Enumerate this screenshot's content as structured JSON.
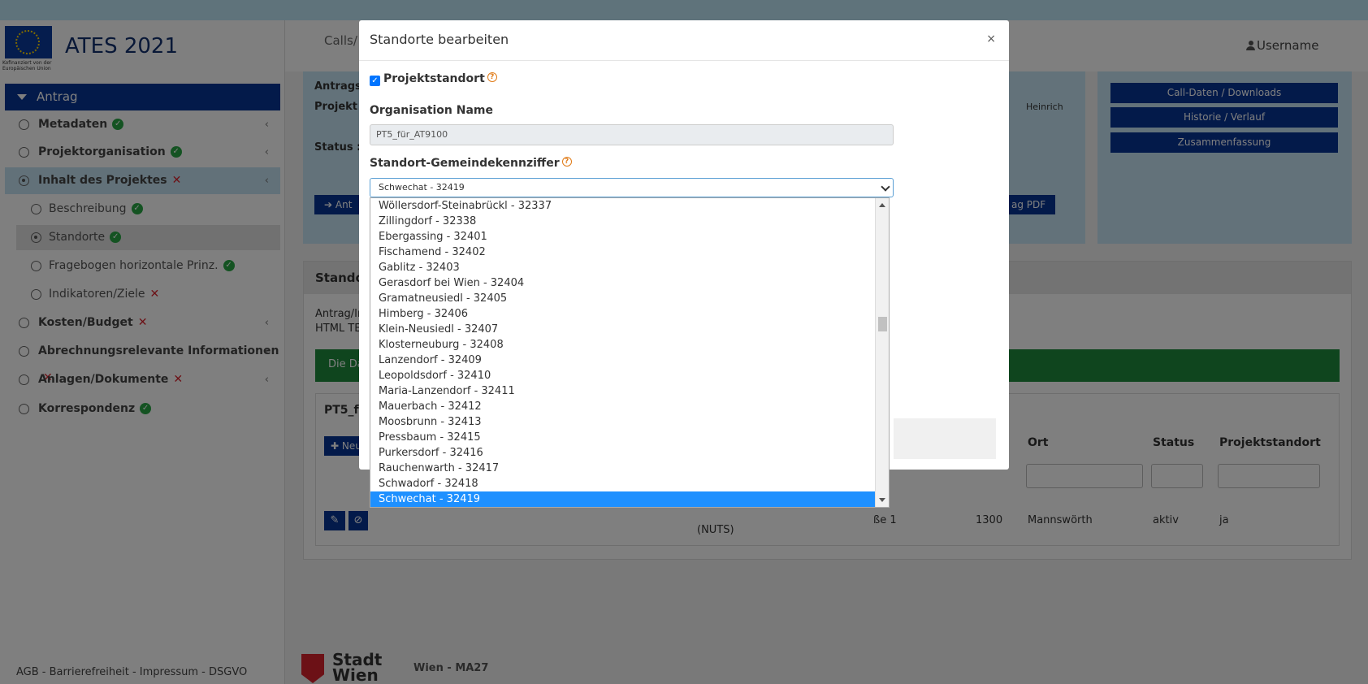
{
  "app": {
    "title": "ATES 2021",
    "logo_caption": "Kofinanziert von der Europäischen Union"
  },
  "sidebar": {
    "active_label": "Antrag",
    "items": [
      {
        "label": "Metadaten",
        "status": "ok"
      },
      {
        "label": "Projektorganisation",
        "status": "ok"
      },
      {
        "label": "Inhalt des Projektes",
        "status": "error"
      },
      {
        "label": "Beschreibung",
        "status": "ok"
      },
      {
        "label": "Standorte",
        "status": "ok"
      },
      {
        "label": "Fragebogen horizontale Prinz.",
        "status": "ok"
      },
      {
        "label": "Indikatoren/Ziele",
        "status": "error"
      },
      {
        "label": "Kosten/Budget",
        "status": "error"
      },
      {
        "label": "Abrechnungsrelevante Informationen",
        "status": "error"
      },
      {
        "label": "Anlagen/Dokumente",
        "status": "error"
      },
      {
        "label": "Korrespondenz",
        "status": "ok"
      }
    ],
    "footer": "AGB - Barrierefreiheit - Impressum - DSGVO"
  },
  "header": {
    "calls": "Calls/",
    "user": "Username"
  },
  "info": {
    "antrag": "Antrags",
    "projekt": "Projekt I",
    "status": "Status :",
    "heinrich": "Heinrich",
    "btn_left": "Ant",
    "btn_pdf": "ag PDF"
  },
  "right_panel": {
    "btns": [
      "Call-Daten / Downloads",
      "Historie / Verlauf",
      "Zusammenfassung"
    ]
  },
  "section": {
    "title": "Standor",
    "text1": "Antrag/In",
    "text2": "HTML TE",
    "green": "Die Da",
    "subtitle": "PT5_fü",
    "new_btn": "Neu",
    "headers": {
      "ort": "Ort",
      "status": "Status",
      "projektstandort": "Projektstandort"
    },
    "row": {
      "strasse": "ße 1",
      "plz": "1300",
      "ort": "Mannswörth",
      "status": "aktiv",
      "projektstandort": "ja",
      "nuts": "(NUTS)"
    }
  },
  "brand": {
    "line1": "Stadt",
    "line2": "Wien",
    "ma": "Wien - MA27"
  },
  "modal": {
    "title": "Standorte bearbeiten",
    "close": "×",
    "checkbox_label": "Projektstandort",
    "org_label": "Organisation Name",
    "org_value": "PT5_für_AT9100",
    "gkz_label": "Standort-Gemeindekennziffer",
    "gkz_selected": "Schwechat - 32419",
    "options": [
      "Wöllersdorf-Steinabrückl - 32337",
      "Zillingdorf - 32338",
      "Ebergassing - 32401",
      "Fischamend - 32402",
      "Gablitz - 32403",
      "Gerasdorf bei Wien - 32404",
      "Gramatneusiedl - 32405",
      "Himberg - 32406",
      "Klein-Neusiedl - 32407",
      "Klosterneuburg - 32408",
      "Lanzendorf - 32409",
      "Leopoldsdorf - 32410",
      "Maria-Lanzendorf - 32411",
      "Mauerbach - 32412",
      "Moosbrunn - 32413",
      "Pressbaum - 32415",
      "Purkersdorf - 32416",
      "Rauchenwarth - 32417",
      "Schwadorf - 32418",
      "Schwechat - 32419"
    ]
  }
}
